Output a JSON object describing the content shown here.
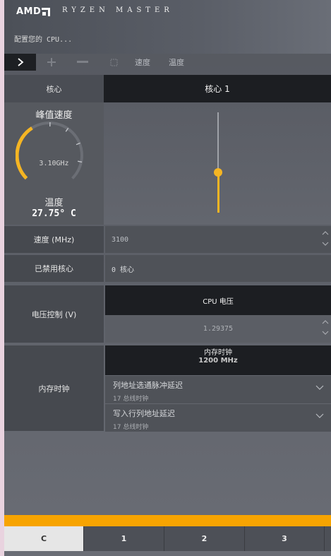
{
  "header": {
    "brand": "AMD",
    "product": "RYZEN MASTER",
    "subtitle": "配置您的 CPU..."
  },
  "toolbar": {
    "expand_icon": "chevron-right-icon",
    "add_icon": "plus-icon",
    "remove_icon": "minus-icon",
    "square_icon": "square-icon",
    "speed_label": "速度",
    "temp_label": "温度"
  },
  "core": {
    "row_label": "核心",
    "selected": "核心 1",
    "peak_speed_label": "峰值速度",
    "speed_value": "3.10GHz",
    "gauge_fraction": 0.38,
    "temp_label": "温度",
    "temp_value": "27.75° C",
    "slider_fraction": 0.4
  },
  "speed_row": {
    "label": "速度 (MHz)",
    "value": "3100"
  },
  "disabled_row": {
    "label": "已禁用核心",
    "value": "0 核心"
  },
  "voltage": {
    "label": "电压控制 (V)",
    "header": "CPU 电压",
    "value": "1.29375"
  },
  "memory": {
    "label": "内存时钟",
    "header": "内存时钟",
    "header_value": "1200 MHz",
    "items": [
      {
        "title": "列地址选通脉冲延迟",
        "sub": "17 总线时钟"
      },
      {
        "title": "写入行列地址延迟",
        "sub": "17 总线时钟"
      }
    ]
  },
  "tabs": [
    "C",
    "1",
    "2",
    "3"
  ],
  "colors": {
    "accent": "#f7a401",
    "dark": "#1c1e22"
  }
}
